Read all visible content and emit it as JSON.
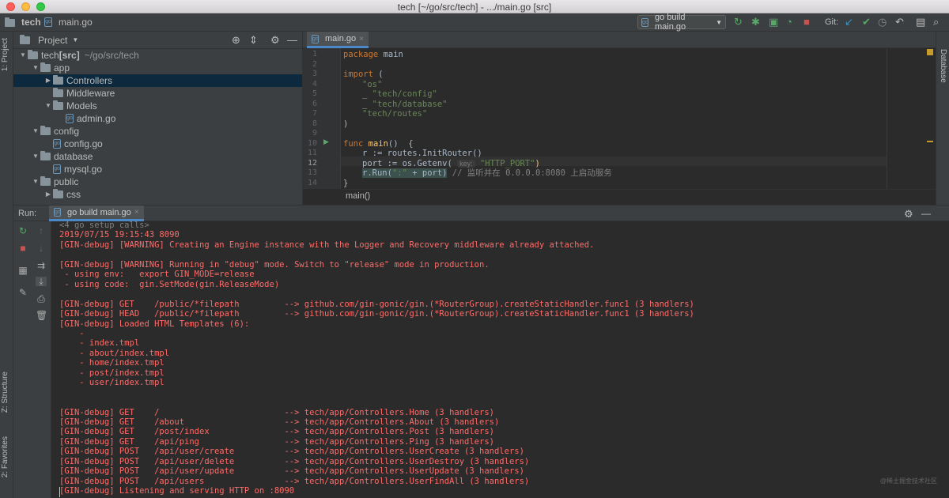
{
  "window": {
    "title": "tech [~/go/src/tech] - .../main.go [src]"
  },
  "navbar": {
    "project_crumb": "tech",
    "file_crumb": "main.go",
    "run_config": "go build main.go",
    "git_label": "Git:"
  },
  "left_strip": {
    "project_tab": "1: Project",
    "structure_tab": "Z: Structure",
    "favorites_tab": "2: Favorites"
  },
  "right_strip": {
    "database_tab": "Database"
  },
  "project_panel": {
    "title": "Project",
    "tree": [
      {
        "label": "tech",
        "suffix": " [src]",
        "path": "~/go/src/tech",
        "indent": 0,
        "type": "folder",
        "arrow": "open"
      },
      {
        "label": "app",
        "indent": 1,
        "type": "folder",
        "arrow": "open"
      },
      {
        "label": "Controllers",
        "indent": 2,
        "type": "folder",
        "arrow": "closed",
        "selected": true
      },
      {
        "label": "Middleware",
        "indent": 2,
        "type": "folder",
        "arrow": "none"
      },
      {
        "label": "Models",
        "indent": 2,
        "type": "folder",
        "arrow": "open"
      },
      {
        "label": "admin.go",
        "indent": 3,
        "type": "go"
      },
      {
        "label": "config",
        "indent": 1,
        "type": "folder",
        "arrow": "open"
      },
      {
        "label": "config.go",
        "indent": 2,
        "type": "go"
      },
      {
        "label": "database",
        "indent": 1,
        "type": "folder",
        "arrow": "open"
      },
      {
        "label": "mysql.go",
        "indent": 2,
        "type": "go"
      },
      {
        "label": "public",
        "indent": 1,
        "type": "folder",
        "arrow": "open"
      },
      {
        "label": "css",
        "indent": 2,
        "type": "folder",
        "arrow": "closed"
      }
    ]
  },
  "editor": {
    "tab_label": "main.go",
    "line_numbers": [
      "1",
      "2",
      "3",
      "4",
      "5",
      "6",
      "7",
      "8",
      "9",
      "10",
      "11",
      "12",
      "13",
      "14"
    ],
    "code": {
      "l1_kw": "package",
      "l1_rest": " main",
      "l3_kw": "import",
      "l3_rest": " (",
      "l4": "\"os\"",
      "l5_us": "_ ",
      "l5": "\"tech/config\"",
      "l6_us": "_ ",
      "l6": "\"tech/database\"",
      "l7": "\"tech/routes\"",
      "l8": ")",
      "l10_kw": "func",
      "l10_fn": "main",
      "l10_rest": "()  {",
      "l11": "r := routes.InitRouter()",
      "l12_a": "port := os.Getenv(",
      "l12_hint": "key:",
      "l12_str": "\"HTTP_PORT\"",
      "l12_b": ")",
      "l13_a": "r.Run(",
      "l13_str": "\":\"",
      "l13_b": " + port)",
      "l13_cm": " // 监听并在 0.0.0.0:8080 上启动服务",
      "l14": "}"
    },
    "breadcrumb": "main()"
  },
  "run_panel": {
    "label": "Run:",
    "tab_label": "go build main.go",
    "lines": [
      {
        "text": "<4 go setup calls>",
        "gray": true
      },
      {
        "text": "2019/07/15 19:15:43 8090"
      },
      {
        "text": "[GIN-debug] [WARNING] Creating an Engine instance with the Logger and Recovery middleware already attached."
      },
      {
        "text": ""
      },
      {
        "text": "[GIN-debug] [WARNING] Running in \"debug\" mode. Switch to \"release\" mode in production."
      },
      {
        "text": " - using env:   export GIN_MODE=release"
      },
      {
        "text": " - using code:  gin.SetMode(gin.ReleaseMode)"
      },
      {
        "text": ""
      },
      {
        "text": "[GIN-debug] GET    /public/*filepath         --> github.com/gin-gonic/gin.(*RouterGroup).createStaticHandler.func1 (3 handlers)"
      },
      {
        "text": "[GIN-debug] HEAD   /public/*filepath         --> github.com/gin-gonic/gin.(*RouterGroup).createStaticHandler.func1 (3 handlers)"
      },
      {
        "text": "[GIN-debug] Loaded HTML Templates (6):"
      },
      {
        "text": "    -"
      },
      {
        "text": "    - index.tmpl"
      },
      {
        "text": "    - about/index.tmpl"
      },
      {
        "text": "    - home/index.tmpl"
      },
      {
        "text": "    - post/index.tmpl"
      },
      {
        "text": "    - user/index.tmpl"
      },
      {
        "text": ""
      },
      {
        "text": ""
      },
      {
        "text": "[GIN-debug] GET    /                         --> tech/app/Controllers.Home (3 handlers)"
      },
      {
        "text": "[GIN-debug] GET    /about                    --> tech/app/Controllers.About (3 handlers)"
      },
      {
        "text": "[GIN-debug] GET    /post/index               --> tech/app/Controllers.Post (3 handlers)"
      },
      {
        "text": "[GIN-debug] GET    /api/ping                 --> tech/app/Controllers.Ping (3 handlers)"
      },
      {
        "text": "[GIN-debug] POST   /api/user/create          --> tech/app/Controllers.UserCreate (3 handlers)"
      },
      {
        "text": "[GIN-debug] POST   /api/user/delete          --> tech/app/Controllers.UserDestroy (3 handlers)"
      },
      {
        "text": "[GIN-debug] POST   /api/user/update          --> tech/app/Controllers.UserUpdate (3 handlers)"
      },
      {
        "text": "[GIN-debug] POST   /api/users                --> tech/app/Controllers.UserFindAll (3 handlers)"
      },
      {
        "text": "[GIN-debug] Listening and serving HTTP on :8090"
      }
    ]
  },
  "watermark": "@稀土掘金技术社区",
  "colors": {
    "console_text": "#ff6b68",
    "keyword": "#cc7832",
    "string": "#6a8759",
    "function": "#ffc66d",
    "selection": "#0d293e"
  }
}
